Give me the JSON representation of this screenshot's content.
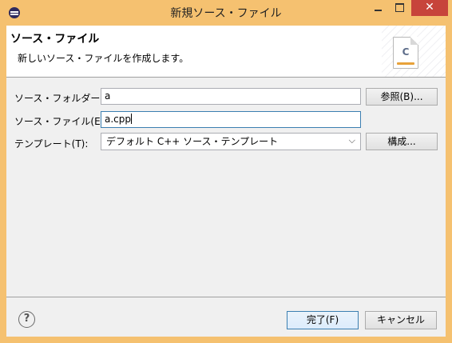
{
  "window": {
    "title": "新規ソース・ファイル",
    "close_glyph": "✕"
  },
  "header": {
    "title": "ソース・ファイル",
    "description": "新しいソース・ファイルを作成します。",
    "icon_letter": "C",
    "icon_name": "c-source-file-icon"
  },
  "form": {
    "source_folder": {
      "label": "ソース・フォルダー(D):",
      "value": "a",
      "button_label": "参照(B)..."
    },
    "source_file": {
      "label": "ソース・ファイル(E):",
      "value": "a.cpp"
    },
    "template": {
      "label": "テンプレート(T):",
      "selected": "デフォルト C++ ソース・テンプレート",
      "button_label": "構成..."
    }
  },
  "footer": {
    "help_glyph": "?",
    "finish_label": "完了(F)",
    "cancel_label": "キャンセル"
  },
  "colors": {
    "titlebar": "#f5c170",
    "close_button": "#c7443b",
    "focus_border": "#3c7fb1",
    "dialog_background": "#f0f0f0"
  }
}
